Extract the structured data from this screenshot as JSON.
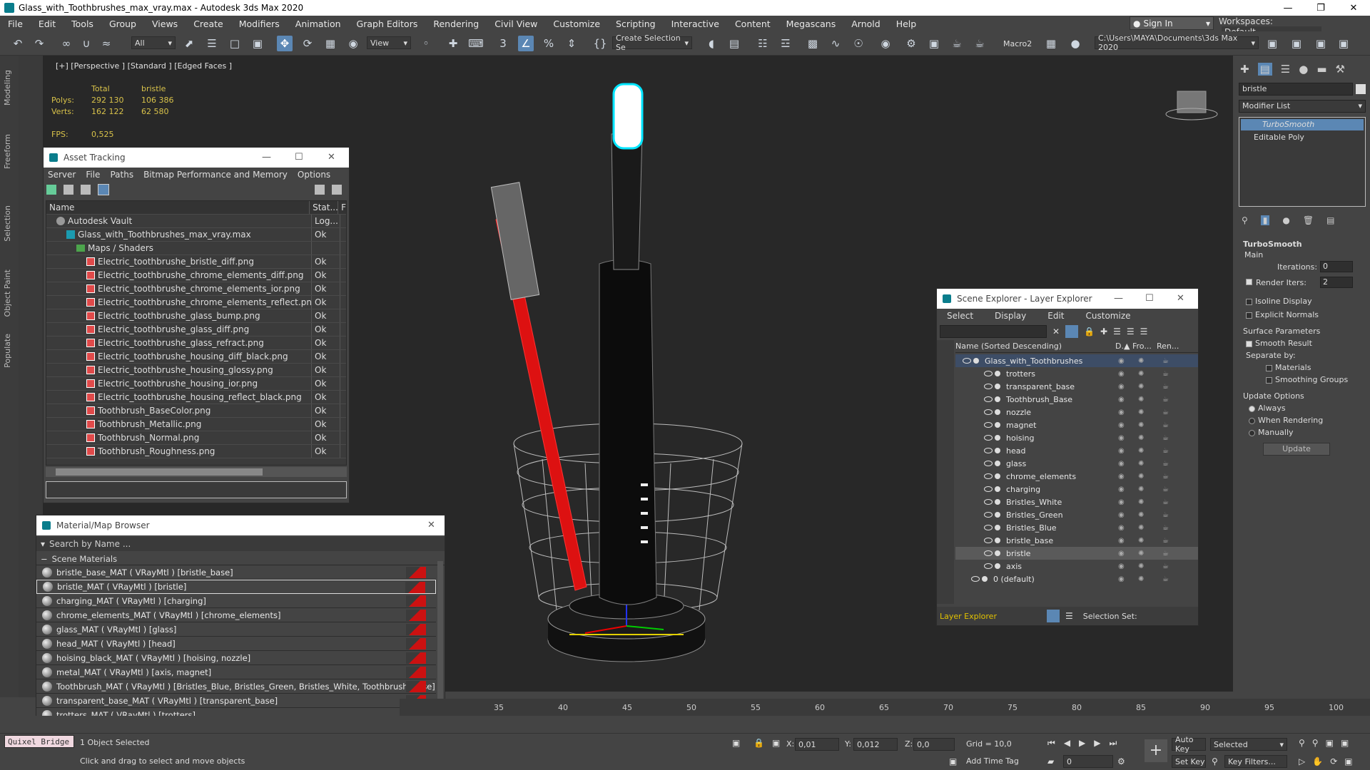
{
  "window": {
    "title": "Glass_with_Toothbrushes_max_vray.max - Autodesk 3ds Max 2020"
  },
  "menu": [
    "File",
    "Edit",
    "Tools",
    "Group",
    "Views",
    "Create",
    "Modifiers",
    "Animation",
    "Graph Editors",
    "Rendering",
    "Civil View",
    "Customize",
    "Scripting",
    "Interactive",
    "Content",
    "Megascans",
    "Arnold",
    "Help"
  ],
  "account": {
    "sign_in": "Sign In",
    "workspaces_label": "Workspaces:",
    "workspace": "Default"
  },
  "toolbar": {
    "filter": "All",
    "ref_coord": "View",
    "selection_set": "Create Selection Se",
    "macro": "Macro2",
    "path": "C:\\Users\\MAYA\\Documents\\3ds Max 2020"
  },
  "left_tabs": [
    "Modeling",
    "Freeform",
    "Selection",
    "Object Paint",
    "Populate"
  ],
  "viewport": {
    "label": "[+] [Perspective ] [Standard ] [Edged Faces ]",
    "stats": {
      "col_total": "Total",
      "col_sel": "bristle",
      "polys_label": "Polys:",
      "polys_total": "292 130",
      "polys_sel": "106 386",
      "verts_label": "Verts:",
      "verts_total": "162 122",
      "verts_sel": "62 580",
      "fps_label": "FPS:",
      "fps": "0,525"
    }
  },
  "asset_tracking": {
    "title": "Asset Tracking",
    "menu": [
      "Server",
      "File",
      "Paths",
      "Bitmap Performance and Memory",
      "Options"
    ],
    "col_name": "Name",
    "col_status": "Stat...",
    "col_extra": "F",
    "rows": [
      {
        "name": "Autodesk Vault",
        "status": "Log...",
        "kind": "vault",
        "level": 1
      },
      {
        "name": "Glass_with_Toothbrushes_max_vray.max",
        "status": "Ok",
        "kind": "max",
        "level": 2
      },
      {
        "name": "Maps / Shaders",
        "status": "",
        "kind": "folder",
        "level": 3
      },
      {
        "name": "Electric_toothbrushe_bristle_diff.png",
        "status": "Ok",
        "kind": "file",
        "level": 4
      },
      {
        "name": "Electric_toothbrushe_chrome_elements_diff.png",
        "status": "Ok",
        "kind": "file",
        "level": 4
      },
      {
        "name": "Electric_toothbrushe_chrome_elements_ior.png",
        "status": "Ok",
        "kind": "file",
        "level": 4
      },
      {
        "name": "Electric_toothbrushe_chrome_elements_reflect.png",
        "status": "Ok",
        "kind": "file",
        "level": 4
      },
      {
        "name": "Electric_toothbrushe_glass_bump.png",
        "status": "Ok",
        "kind": "file",
        "level": 4
      },
      {
        "name": "Electric_toothbrushe_glass_diff.png",
        "status": "Ok",
        "kind": "file",
        "level": 4
      },
      {
        "name": "Electric_toothbrushe_glass_refract.png",
        "status": "Ok",
        "kind": "file",
        "level": 4
      },
      {
        "name": "Electric_toothbrushe_housing_diff_black.png",
        "status": "Ok",
        "kind": "file",
        "level": 4
      },
      {
        "name": "Electric_toothbrushe_housing_glossy.png",
        "status": "Ok",
        "kind": "file",
        "level": 4
      },
      {
        "name": "Electric_toothbrushe_housing_ior.png",
        "status": "Ok",
        "kind": "file",
        "level": 4
      },
      {
        "name": "Electric_toothbrushe_housing_reflect_black.png",
        "status": "Ok",
        "kind": "file",
        "level": 4
      },
      {
        "name": "Toothbrush_BaseColor.png",
        "status": "Ok",
        "kind": "file",
        "level": 4
      },
      {
        "name": "Toothbrush_Metallic.png",
        "status": "Ok",
        "kind": "file",
        "level": 4
      },
      {
        "name": "Toothbrush_Normal.png",
        "status": "Ok",
        "kind": "file",
        "level": 4
      },
      {
        "name": "Toothbrush_Roughness.png",
        "status": "Ok",
        "kind": "file",
        "level": 4
      }
    ]
  },
  "material_browser": {
    "title": "Material/Map Browser",
    "search_placeholder": "Search by Name ...",
    "section": "Scene Materials",
    "items": [
      "bristle_base_MAT ( VRayMtl ) [bristle_base]",
      "bristle_MAT ( VRayMtl ) [bristle]",
      "charging_MAT ( VRayMtl ) [charging]",
      "chrome_elements_MAT ( VRayMtl ) [chrome_elements]",
      "glass_MAT ( VRayMtl ) [glass]",
      "head_MAT ( VRayMtl ) [head]",
      "hoising_black_MAT ( VRayMtl ) [hoising, nozzle]",
      "metal_MAT ( VRayMtl ) [axis, magnet]",
      "Toothbrush_MAT ( VRayMtl ) [Bristles_Blue, Bristles_Green, Bristles_White, Toothbrush_Base]",
      "transparent_base_MAT ( VRayMtl ) [transparent_base]",
      "trotters_MAT ( VRayMtl ) [trotters]"
    ],
    "selected_index": 1
  },
  "scene_explorer": {
    "title": "Scene Explorer - Layer Explorer",
    "menu": [
      "Select",
      "Display",
      "Edit",
      "Customize"
    ],
    "col_name": "Name (Sorted Descending)",
    "col_d": "D.▲",
    "col_fro": "Fro...",
    "col_ren": "Ren...",
    "root": "Glass_with_Toothbrushes",
    "objects": [
      "trotters",
      "transparent_base",
      "Toothbrush_Base",
      "nozzle",
      "magnet",
      "hoising",
      "head",
      "glass",
      "chrome_elements",
      "charging",
      "Bristles_White",
      "Bristles_Green",
      "Bristles_Blue",
      "bristle_base",
      "bristle",
      "axis"
    ],
    "selected": "bristle",
    "default_layer": "0 (default)",
    "footer_dropdown": "Layer Explorer",
    "selection_set_label": "Selection Set:"
  },
  "command_panel": {
    "object_name": "bristle",
    "modifier_list": "Modifier List",
    "stack": [
      "TurboSmooth",
      "Editable Poly"
    ],
    "rollout_title": "TurboSmooth",
    "main_label": "Main",
    "iterations_label": "Iterations:",
    "iterations": "0",
    "render_iters_label": "Render Iters:",
    "render_iters": "2",
    "isoline": "Isoline Display",
    "explicit_normals": "Explicit Normals",
    "surface_params": "Surface Parameters",
    "smooth_result": "Smooth Result",
    "separate_by": "Separate by:",
    "materials": "Materials",
    "smoothing_groups": "Smoothing Groups",
    "update_options": "Update Options",
    "always": "Always",
    "when_rendering": "When Rendering",
    "manually": "Manually",
    "update_button": "Update"
  },
  "timeline": {
    "ticks": [
      "35",
      "40",
      "45",
      "50",
      "55",
      "60",
      "65",
      "70",
      "75",
      "80",
      "85",
      "90",
      "95",
      "100"
    ]
  },
  "status": {
    "quixel": "Quixel Bridge",
    "selected": "1 Object Selected",
    "prompt": "Click and drag to select and move objects",
    "x_label": "X:",
    "x": "0,01",
    "y_label": "Y:",
    "y": "0,012",
    "z_label": "Z:",
    "z": "0,0",
    "grid": "Grid = 10,0",
    "add_time_tag": "Add Time Tag",
    "auto_key": "Auto Key",
    "set_key": "Set Key",
    "key_mode": "Selected",
    "key_filters": "Key Filters...",
    "frame": "0"
  }
}
